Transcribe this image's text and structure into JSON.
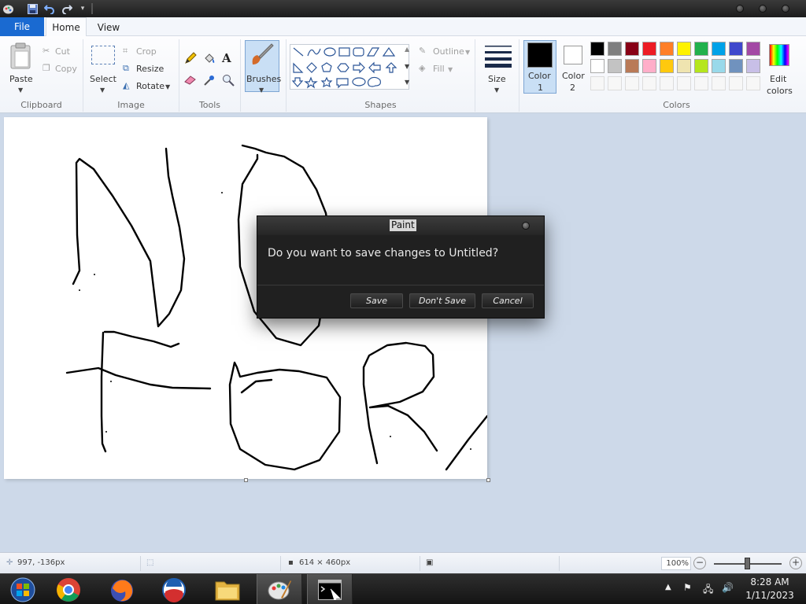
{
  "app": {
    "title": "Paint",
    "quick_access": [
      "paint-app-icon",
      "save-icon",
      "undo-icon",
      "redo-icon",
      "customize-quick-access-icon"
    ]
  },
  "tabs": {
    "file": "File",
    "home": "Home",
    "view": "View"
  },
  "ribbon": {
    "clipboard": {
      "paste": "Paste",
      "cut": "Cut",
      "copy": "Copy",
      "label": "Clipboard"
    },
    "image": {
      "select": "Select",
      "crop": "Crop",
      "resize": "Resize",
      "rotate": "Rotate",
      "label": "Image"
    },
    "tools": {
      "label": "Tools",
      "text_tool": "A"
    },
    "brushes": {
      "label": "Brushes"
    },
    "shapes": {
      "outline": "Outline",
      "fill": "Fill",
      "label": "Shapes"
    },
    "size": {
      "label": "Size"
    },
    "color1": {
      "label_line1": "Color",
      "label_line2": "1",
      "value": "#000000"
    },
    "color2": {
      "label_line1": "Color",
      "label_line2": "2",
      "value": "#ffffff"
    },
    "colors": {
      "label": "Colors",
      "edit_line1": "Edit",
      "edit_line2": "colors",
      "palette_row1": [
        "#000000",
        "#7f7f7f",
        "#880015",
        "#ed1c24",
        "#ff7f27",
        "#fff200",
        "#22b14c",
        "#00a2e8",
        "#3f48cc",
        "#a349a4"
      ],
      "palette_row2": [
        "#ffffff",
        "#c3c3c3",
        "#b97a57",
        "#ffaec9",
        "#ffc90e",
        "#efe4b0",
        "#b5e61d",
        "#99d9ea",
        "#7092be",
        "#c8bfe7"
      ]
    }
  },
  "dialog": {
    "title": "Paint",
    "message": "Do you want to save changes to Untitled?",
    "save": "Save",
    "dont_save": "Don't Save",
    "cancel": "Cancel"
  },
  "status": {
    "cursor_position": "997, -136px",
    "canvas_size": "614 × 460px",
    "zoom": "100%"
  },
  "taskbar": {
    "apps": [
      "start-orb-icon",
      "chrome-icon",
      "firefox-icon",
      "obama-logo-icon",
      "file-explorer-icon",
      "paint-icon",
      "command-prompt-icon"
    ],
    "time": "8:28 AM",
    "date": "1/11/2023"
  }
}
